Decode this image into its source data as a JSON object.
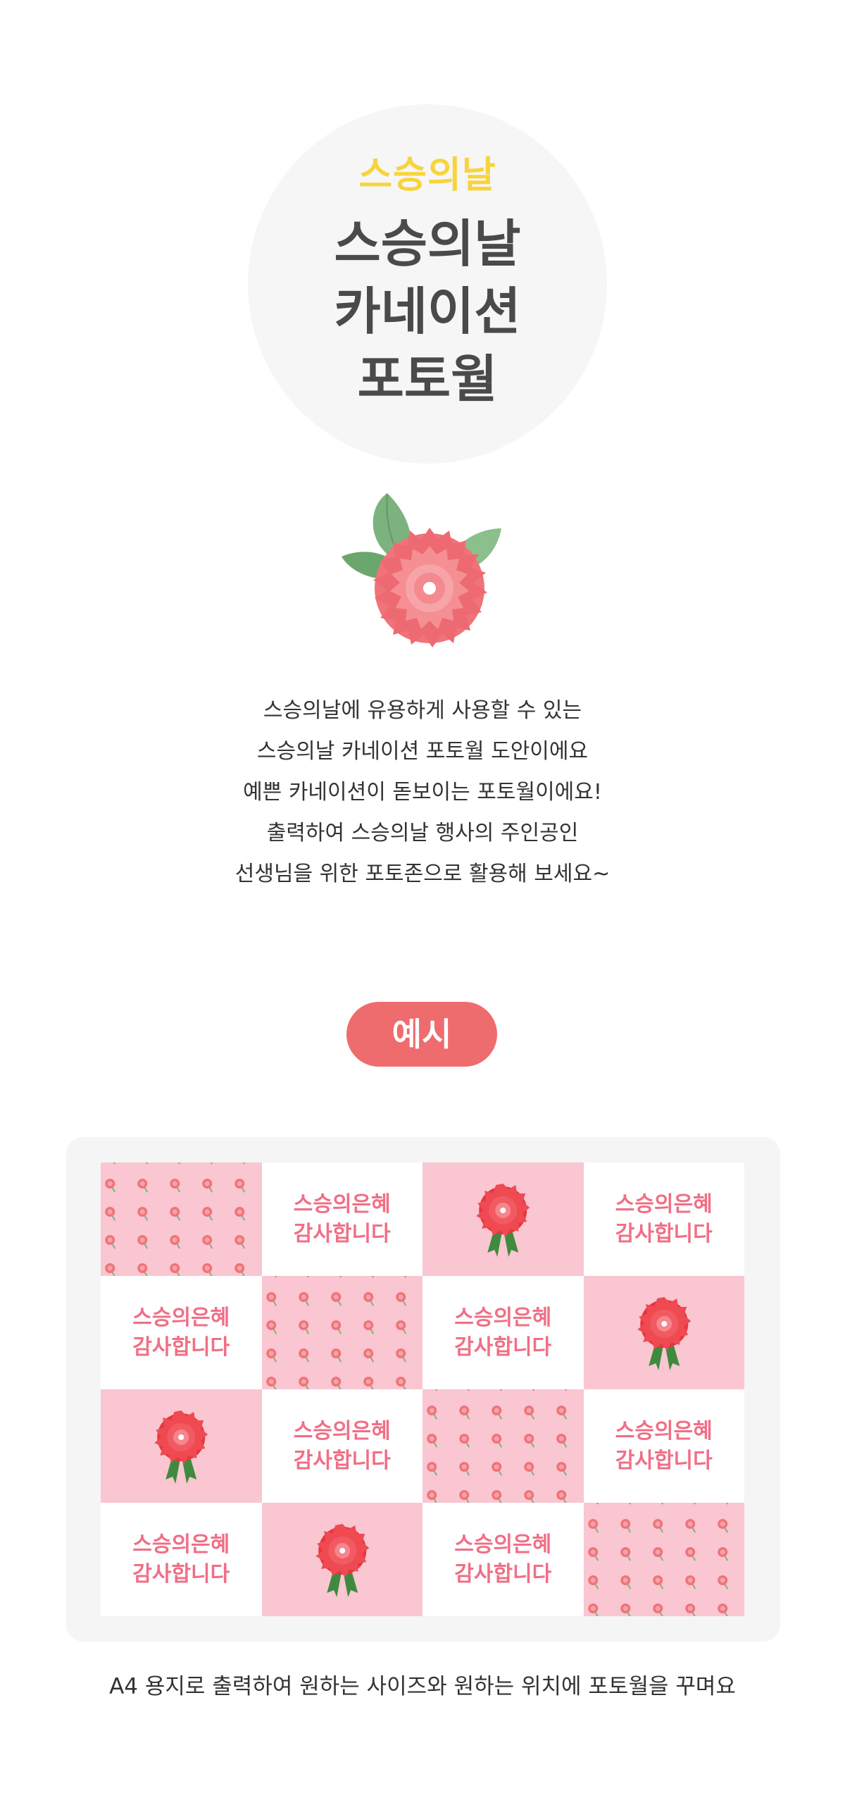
{
  "hero": {
    "subtitle": "스승의날",
    "title_lines": [
      "스승의날",
      "카네이션",
      "포토월"
    ]
  },
  "description": [
    "스승의날에 유용하게 사용할 수 있는",
    "스승의날 카네이션 포토월 도안이에요",
    "예쁜 카네이션이 돋보이는 포토월이에요!",
    "출력하여 스승의날 행사의 주인공인",
    "선생님을 위한 포토존으로 활용해 보세요~"
  ],
  "example_label": "예시",
  "tile_text": [
    "스승의은혜",
    "감사합니다"
  ],
  "grid": [
    [
      "pattern",
      "text",
      "flower",
      "text"
    ],
    [
      "text",
      "pattern",
      "text",
      "flower"
    ],
    [
      "flower",
      "text",
      "pattern",
      "text"
    ],
    [
      "text",
      "flower",
      "text",
      "pattern"
    ]
  ],
  "caption": "A4 용지로 출력하여 원하는 사이즈와 원하는 위치에 포토월을 꾸며요",
  "colors": {
    "accent": "#ef6c6e",
    "subtitle": "#f7d43c",
    "tile_pink": "#f9c6d1",
    "tile_text": "#f06f86"
  },
  "icons": [
    "carnation-icon",
    "carnation-ribbon-icon",
    "carnation-pattern"
  ]
}
